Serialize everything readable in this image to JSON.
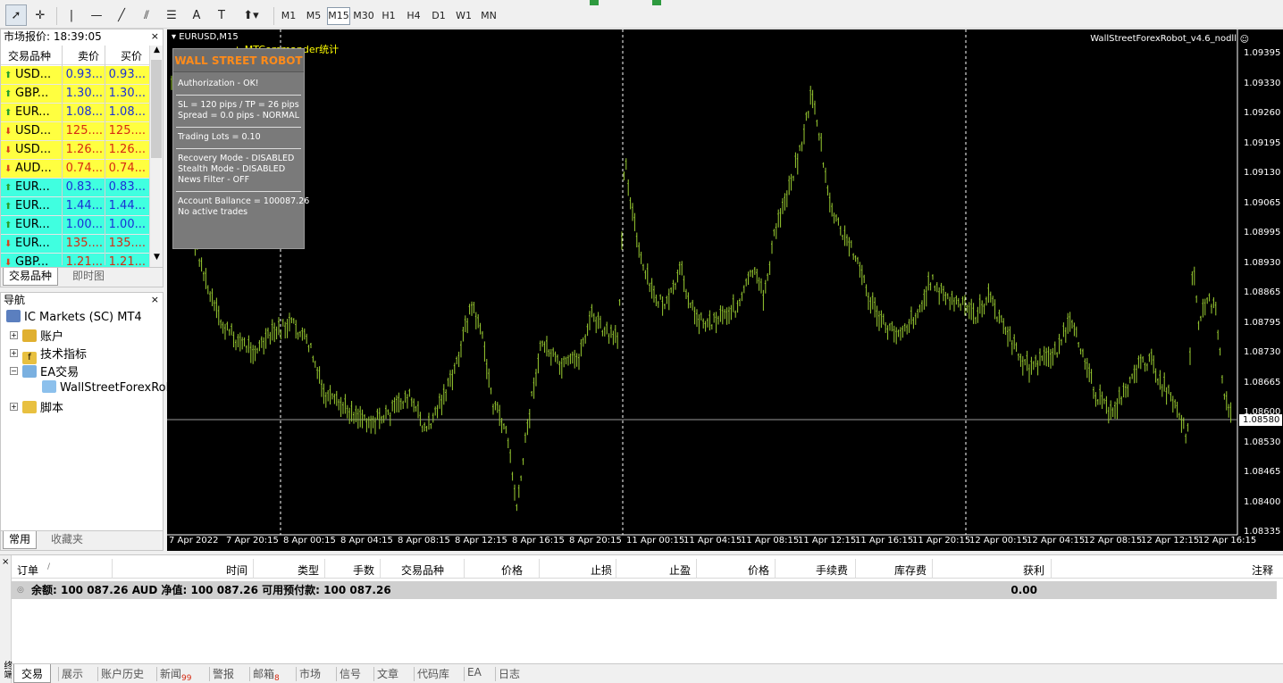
{
  "toolbar": {
    "timeframes": [
      "M1",
      "M5",
      "M15",
      "M30",
      "H1",
      "H4",
      "D1",
      "W1",
      "MN"
    ],
    "active_timeframe": "M15"
  },
  "market_watch": {
    "title": "市场报价: 18:39:05",
    "columns": [
      "交易品种",
      "卖价",
      "买价"
    ],
    "rows": [
      {
        "symbol": "USD...",
        "bid": "0.93...",
        "ask": "0.93...",
        "dir": "up",
        "bg": "#ffff40"
      },
      {
        "symbol": "GBP...",
        "bid": "1.30...",
        "ask": "1.30...",
        "dir": "up",
        "bg": "#ffff40"
      },
      {
        "symbol": "EUR...",
        "bid": "1.08...",
        "ask": "1.08...",
        "dir": "up",
        "bg": "#ffff40"
      },
      {
        "symbol": "USD...",
        "bid": "125....",
        "ask": "125....",
        "dir": "down",
        "bg": "#ffff40"
      },
      {
        "symbol": "USD...",
        "bid": "1.26...",
        "ask": "1.26...",
        "dir": "down",
        "bg": "#ffff40"
      },
      {
        "symbol": "AUD...",
        "bid": "0.74...",
        "ask": "0.74...",
        "dir": "down",
        "bg": "#ffff40"
      },
      {
        "symbol": "EUR...",
        "bid": "0.83...",
        "ask": "0.83...",
        "dir": "up",
        "bg": "#40ffe0"
      },
      {
        "symbol": "EUR...",
        "bid": "1.44...",
        "ask": "1.44...",
        "dir": "up",
        "bg": "#40ffe0"
      },
      {
        "symbol": "EUR...",
        "bid": "1.00...",
        "ask": "1.00...",
        "dir": "up",
        "bg": "#40ffe0"
      },
      {
        "symbol": "EUR...",
        "bid": "135....",
        "ask": "135....",
        "dir": "down",
        "bg": "#40ffe0"
      },
      {
        "symbol": "GBP...",
        "bid": "1.21...",
        "ask": "1.21...",
        "dir": "down",
        "bg": "#40ffe0"
      }
    ],
    "tabs": [
      "交易品种",
      "即时图"
    ]
  },
  "navigator": {
    "title": "导航",
    "root": "IC Markets (SC) MT4",
    "items": [
      {
        "label": "账户",
        "icon": "accounts-icon"
      },
      {
        "label": "技术指标",
        "icon": "indicators-icon"
      },
      {
        "label": "EA交易",
        "icon": "expert-advisors-icon"
      },
      {
        "label": "WallStreetForexRol",
        "icon": "expert-icon"
      },
      {
        "label": "脚本",
        "icon": "scripts-icon"
      }
    ],
    "tabs": [
      "常用",
      "收藏夹"
    ]
  },
  "chart": {
    "title": "EURUSD,M15",
    "robot_name": "WallStreetForexRobot_v4.6_nodll",
    "commander": "MTCommander统计",
    "current_price": "1.08580",
    "y_labels": [
      "1.09395",
      "1.09330",
      "1.09260",
      "1.09195",
      "1.09130",
      "1.09065",
      "1.08995",
      "1.08930",
      "1.08865",
      "1.08795",
      "1.08730",
      "1.08665",
      "1.08600",
      "1.08530",
      "1.08465",
      "1.08400",
      "1.08335"
    ],
    "x_labels": [
      "7 Apr 2022",
      "7 Apr 20:15",
      "8 Apr 00:15",
      "8 Apr 04:15",
      "8 Apr 08:15",
      "8 Apr 12:15",
      "8 Apr 16:15",
      "8 Apr 20:15",
      "11 Apr 00:15",
      "11 Apr 04:15",
      "11 Apr 08:15",
      "11 Apr 12:15",
      "11 Apr 16:15",
      "11 Apr 20:15",
      "12 Apr 00:15",
      "12 Apr 04:15",
      "12 Apr 08:15",
      "12 Apr 12:15",
      "12 Apr 16:15"
    ],
    "bar_color": "#9acd32",
    "ea_panel": {
      "header": "WALL STREET ROBOT",
      "lines": [
        "Authorization - OK!",
        "SL = 120 pips / TP = 26 pips",
        "Spread = 0.0 pips - NORMAL",
        "Trading Lots = 0.10",
        "Recovery Mode - DISABLED",
        "Stealth Mode - DISABLED",
        "News Filter - OFF",
        "Account Ballance = 100087.26",
        "No active trades"
      ]
    }
  },
  "terminal": {
    "columns": [
      "订单",
      "/",
      "时间",
      "类型",
      "手数",
      "交易品种",
      "价格",
      "止损",
      "止盈",
      "价格",
      "手续费",
      "库存费",
      "获利",
      "注释"
    ],
    "balance_text": "余额: 100 087.26 AUD  净值: 100 087.26  可用预付款: 100 087.26",
    "profit": "0.00",
    "side_label": "终端",
    "tabs": [
      {
        "label": "交易",
        "badge": ""
      },
      {
        "label": "展示",
        "badge": ""
      },
      {
        "label": "账户历史",
        "badge": ""
      },
      {
        "label": "新闻",
        "badge": "99"
      },
      {
        "label": "警报",
        "badge": ""
      },
      {
        "label": "邮箱",
        "badge": "8"
      },
      {
        "label": "市场",
        "badge": ""
      },
      {
        "label": "信号",
        "badge": ""
      },
      {
        "label": "文章",
        "badge": ""
      },
      {
        "label": "代码库",
        "badge": ""
      },
      {
        "label": "EA",
        "badge": ""
      },
      {
        "label": "日志",
        "badge": ""
      }
    ]
  }
}
